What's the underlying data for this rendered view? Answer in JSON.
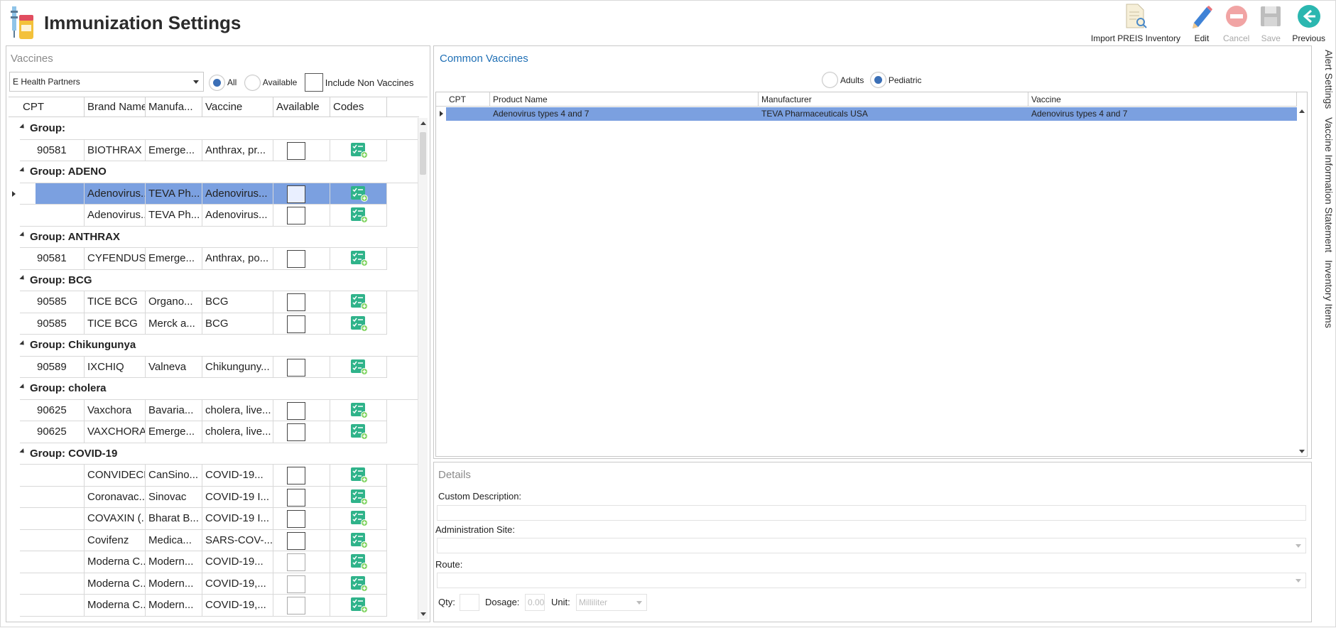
{
  "header": {
    "title": "Immunization Settings"
  },
  "toolbar": {
    "import": {
      "label": "Import PREIS Inventory",
      "icon": "document-search-icon",
      "enabled": true
    },
    "edit": {
      "label": "Edit",
      "icon": "pencil-icon",
      "enabled": true
    },
    "cancel": {
      "label": "Cancel",
      "icon": "cancel-icon",
      "enabled": false
    },
    "save": {
      "label": "Save",
      "icon": "floppy-disk-icon",
      "enabled": false
    },
    "previous": {
      "label": "Previous",
      "icon": "back-arrow-icon",
      "enabled": true
    }
  },
  "vaccines_panel": {
    "title": "Vaccines",
    "practice_select": {
      "value": "E Health Partners"
    },
    "filter": {
      "all_label": "All",
      "available_label": "Available",
      "selected": "All",
      "include_non_vaccines_label": "Include Non Vaccines",
      "include_non_vaccines_checked": false
    },
    "columns": [
      "CPT",
      "Brand Name",
      "Manufa...",
      "Vaccine",
      "Available",
      "Codes"
    ],
    "rows": [
      {
        "type": "group",
        "label": "Group:"
      },
      {
        "type": "item",
        "cpt": "90581",
        "brand": "BIOTHRAX",
        "manufacturer": "Emerge...",
        "vaccine": "Anthrax, pr...",
        "available": false
      },
      {
        "type": "group",
        "label": "Group: ADENO"
      },
      {
        "type": "item",
        "cpt": "",
        "brand": "Adenovirus...",
        "manufacturer": "TEVA Ph...",
        "vaccine": "Adenovirus...",
        "available": false,
        "selected": true
      },
      {
        "type": "item",
        "cpt": "",
        "brand": "Adenovirus...",
        "manufacturer": "TEVA Ph...",
        "vaccine": "Adenovirus...",
        "available": false
      },
      {
        "type": "group",
        "label": "Group: ANTHRAX"
      },
      {
        "type": "item",
        "cpt": "90581",
        "brand": "CYFENDUS",
        "manufacturer": "Emerge...",
        "vaccine": "Anthrax, po...",
        "available": false
      },
      {
        "type": "group",
        "label": "Group: BCG"
      },
      {
        "type": "item",
        "cpt": "90585",
        "brand": "TICE BCG",
        "manufacturer": "Organo...",
        "vaccine": "BCG",
        "available": false
      },
      {
        "type": "item",
        "cpt": "90585",
        "brand": "TICE BCG",
        "manufacturer": "Merck a...",
        "vaccine": "BCG",
        "available": false
      },
      {
        "type": "group",
        "label": "Group: Chikungunya"
      },
      {
        "type": "item",
        "cpt": "90589",
        "brand": "IXCHIQ",
        "manufacturer": "Valneva",
        "vaccine": "Chikunguny...",
        "available": false
      },
      {
        "type": "group",
        "label": "Group: cholera"
      },
      {
        "type": "item",
        "cpt": "90625",
        "brand": "Vaxchora",
        "manufacturer": "Bavaria...",
        "vaccine": "cholera, live...",
        "available": false
      },
      {
        "type": "item",
        "cpt": "90625",
        "brand": "VAXCHORA",
        "manufacturer": "Emerge...",
        "vaccine": "cholera, live...",
        "available": false
      },
      {
        "type": "group",
        "label": "Group: COVID-19"
      },
      {
        "type": "item",
        "cpt": "",
        "brand": "CONVIDECI...",
        "manufacturer": "CanSino...",
        "vaccine": "COVID-19...",
        "available": false
      },
      {
        "type": "item",
        "cpt": "",
        "brand": "Coronavac...",
        "manufacturer": "Sinovac",
        "vaccine": "COVID-19 I...",
        "available": false
      },
      {
        "type": "item",
        "cpt": "",
        "brand": "COVAXIN (...",
        "manufacturer": "Bharat B...",
        "vaccine": "COVID-19 I...",
        "available": false
      },
      {
        "type": "item",
        "cpt": "",
        "brand": "Covifenz",
        "manufacturer": "Medica...",
        "vaccine": "SARS-COV-...",
        "available": false
      },
      {
        "type": "item",
        "cpt": "",
        "brand": "Moderna C...",
        "manufacturer": "Modern...",
        "vaccine": "COVID-19...",
        "available": false,
        "light": true
      },
      {
        "type": "item",
        "cpt": "",
        "brand": "Moderna C...",
        "manufacturer": "Modern...",
        "vaccine": "COVID-19,...",
        "available": false,
        "light": true
      },
      {
        "type": "item",
        "cpt": "",
        "brand": "Moderna C...",
        "manufacturer": "Modern...",
        "vaccine": "COVID-19,...",
        "available": false,
        "light": true
      }
    ]
  },
  "common_vaccines": {
    "title": "Common Vaccines",
    "audience": {
      "adults_label": "Adults",
      "pediatric_label": "Pediatric",
      "selected": "Pediatric"
    },
    "columns": [
      "CPT",
      "Product Name",
      "Manufacturer",
      "Vaccine"
    ],
    "rows": [
      {
        "cpt": "",
        "product_name": "Adenovirus types 4 and 7",
        "manufacturer": "TEVA Pharmaceuticals USA",
        "vaccine": "Adenovirus types 4 and 7",
        "selected": true
      }
    ]
  },
  "details": {
    "title": "Details",
    "custom_description_label": "Custom Description:",
    "custom_description_value": "",
    "administration_site_label": "Administration Site:",
    "administration_site_value": "",
    "route_label": "Route:",
    "route_value": "",
    "qty_label": "Qty:",
    "qty_value": "",
    "dosage_label": "Dosage:",
    "dosage_value": "0.00",
    "unit_label": "Unit:",
    "unit_value": "Milliliter"
  },
  "side_tabs": [
    "Alert Settings",
    "Vaccine Information Statement",
    "Inventory Items"
  ],
  "colors": {
    "selection": "#7ba0e0",
    "accent_blue": "#3b6fb6",
    "title_blue": "#1f6fb5",
    "codes_icon_green": "#2fb38a",
    "previous_teal": "#2bb7b0",
    "cancel_red": "#e07a7a"
  }
}
